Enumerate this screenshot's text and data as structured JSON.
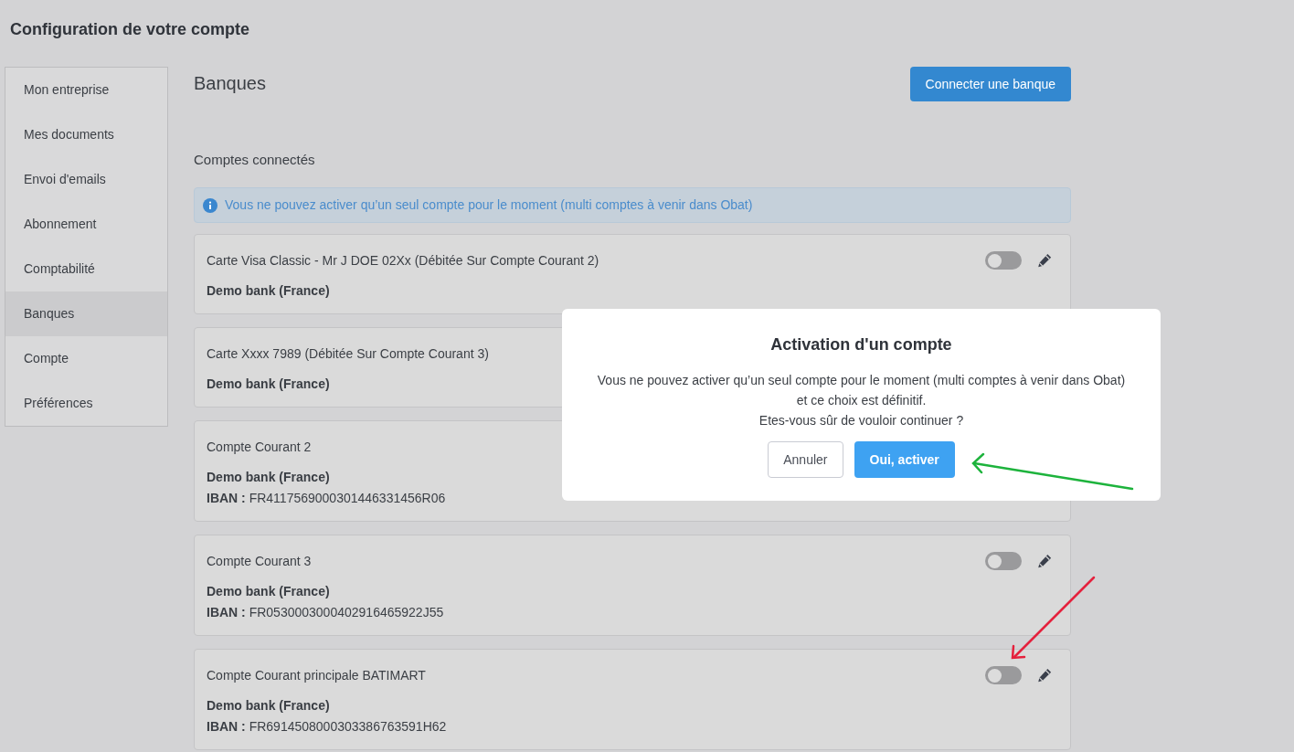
{
  "page_title": "Configuration de votre compte",
  "sidebar": {
    "items": [
      {
        "label": "Mon entreprise",
        "selected": false
      },
      {
        "label": "Mes documents",
        "selected": false
      },
      {
        "label": "Envoi d'emails",
        "selected": false
      },
      {
        "label": "Abonnement",
        "selected": false
      },
      {
        "label": "Comptabilité",
        "selected": false
      },
      {
        "label": "Banques",
        "selected": true
      },
      {
        "label": "Compte",
        "selected": false
      },
      {
        "label": "Préférences",
        "selected": false
      }
    ]
  },
  "section_title": "Banques",
  "connect_button": "Connecter une banque",
  "subsection_title": "Comptes connectés",
  "info_alert": "Vous ne pouvez activer qu’un seul compte pour le moment (multi comptes à venir dans Obat)",
  "accounts": [
    {
      "name": "Carte Visa Classic - Mr J DOE 02Xx (Débitée Sur Compte Courant 2)",
      "bank": "Demo bank (France)",
      "on": false
    },
    {
      "name": "Carte Xxxx 7989 (Débitée Sur Compte Courant 3)",
      "bank": "Demo bank (France)"
    },
    {
      "name": "Compte Courant 2",
      "bank": "Demo bank (France)",
      "iban_label": "IBAN :",
      "iban": "FR4117569000301446331456R06"
    },
    {
      "name": "Compte Courant 3",
      "bank": "Demo bank (France)",
      "iban_label": "IBAN :",
      "iban": "FR0530003000402916465922J55",
      "on": false
    },
    {
      "name": "Compte Courant principale BATIMART",
      "bank": "Demo bank (France)",
      "iban_label": "IBAN :",
      "iban": "FR6914508000303386763591H62",
      "on": false
    }
  ],
  "dialog": {
    "title": "Activation d'un compte",
    "message_lines": [
      "Vous ne pouvez activer qu’un seul compte pour le moment (multi comptes à venir dans Obat)",
      "et ce choix est définitif.",
      "Etes-vous sûr de vouloir continuer ?"
    ],
    "cancel_button": "Annuler",
    "confirm_button": "Oui, activer"
  }
}
